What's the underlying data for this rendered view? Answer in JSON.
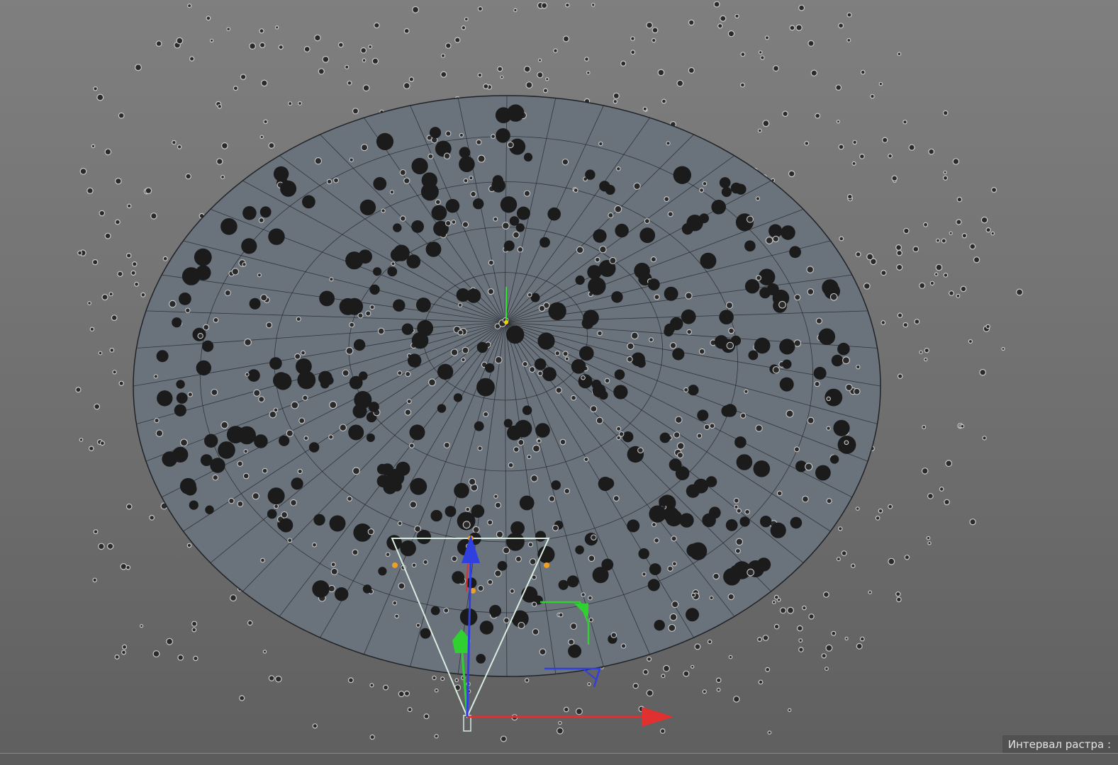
{
  "viewport": {
    "name": "3D viewport",
    "grid_spacing_label": "Интервал растра : ",
    "background_color": "#777777"
  },
  "scene": {
    "disc_color": "#6a727c",
    "disc_edge_color": "#1f2226",
    "particle_color": "#2a2a2a",
    "particle_ring_color": "#c8c8c8"
  },
  "gizmo": {
    "axis_x_color": "#e03030",
    "axis_y_color": "#30d030",
    "axis_z_color": "#3040e0",
    "camera_frame_color": "#d8ece0",
    "handle_color": "#f0a020"
  }
}
